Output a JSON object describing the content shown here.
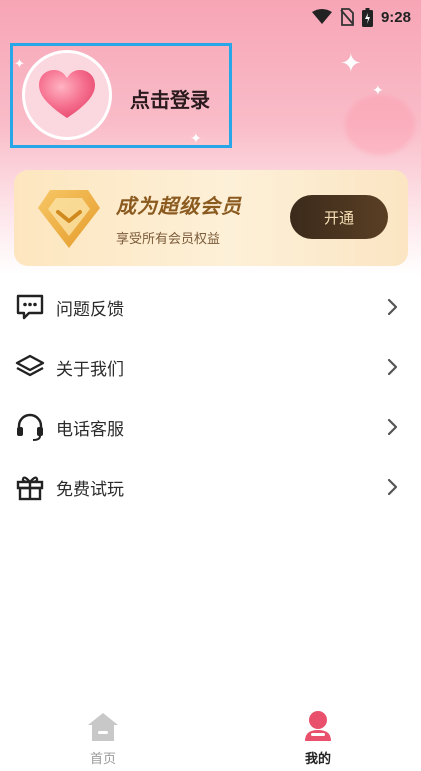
{
  "status_bar": {
    "time": "9:28",
    "icons": [
      "wifi-icon",
      "no-sim-icon",
      "battery-icon"
    ]
  },
  "profile": {
    "login_text": "点击登录",
    "avatar_icon": "heart-icon"
  },
  "vip": {
    "title": "成为超级会员",
    "subtitle": "享受所有会员权益",
    "button_label": "开通",
    "badge_icon": "vip-diamond-icon"
  },
  "menu": {
    "items": [
      {
        "label": "问题反馈",
        "icon": "feedback-icon"
      },
      {
        "label": "关于我们",
        "icon": "layers-icon"
      },
      {
        "label": "电话客服",
        "icon": "headset-icon"
      },
      {
        "label": "免费试玩",
        "icon": "gift-icon"
      }
    ]
  },
  "tabbar": {
    "tabs": [
      {
        "label": "首页",
        "icon": "home-icon",
        "active": false
      },
      {
        "label": "我的",
        "icon": "user-icon",
        "active": true
      }
    ],
    "active_color": "#e8506b",
    "inactive_color": "#9a9a9a"
  },
  "colors": {
    "header_pink": "#f7a5b6",
    "highlight_box": "#27a7e8",
    "vip_gold": "#8a5a1f"
  }
}
